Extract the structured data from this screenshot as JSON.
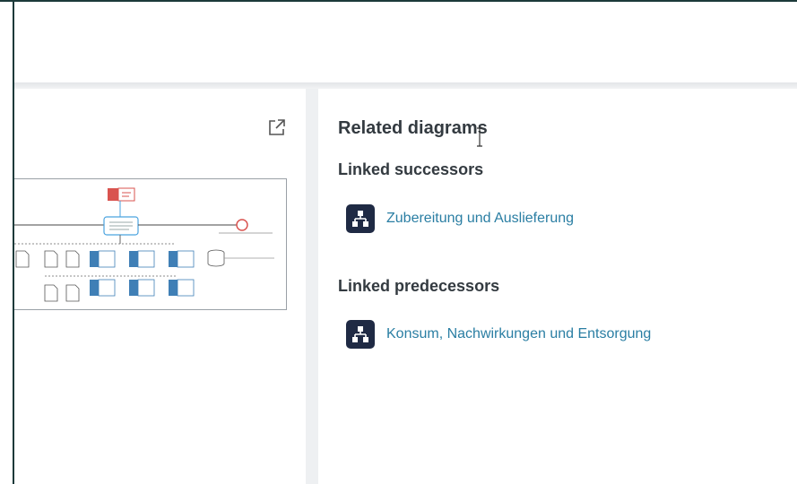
{
  "right_panel": {
    "title": "Related diagrams",
    "successors": {
      "heading": "Linked successors",
      "items": [
        {
          "label": "Zubereitung und Auslieferung",
          "icon": "process-diagram-icon"
        }
      ]
    },
    "predecessors": {
      "heading": "Linked predecessors",
      "items": [
        {
          "label": "Konsum, Nachwirkungen und Entsorgung",
          "icon": "process-diagram-icon"
        }
      ]
    }
  },
  "left_panel": {
    "open_icon": "external-link-icon",
    "thumbnail_icon": "diagram-thumbnail"
  },
  "colors": {
    "link": "#2a7ea3",
    "icon_bg": "#1f2a44",
    "heading": "#333a40",
    "event_red": "#d9534f"
  }
}
